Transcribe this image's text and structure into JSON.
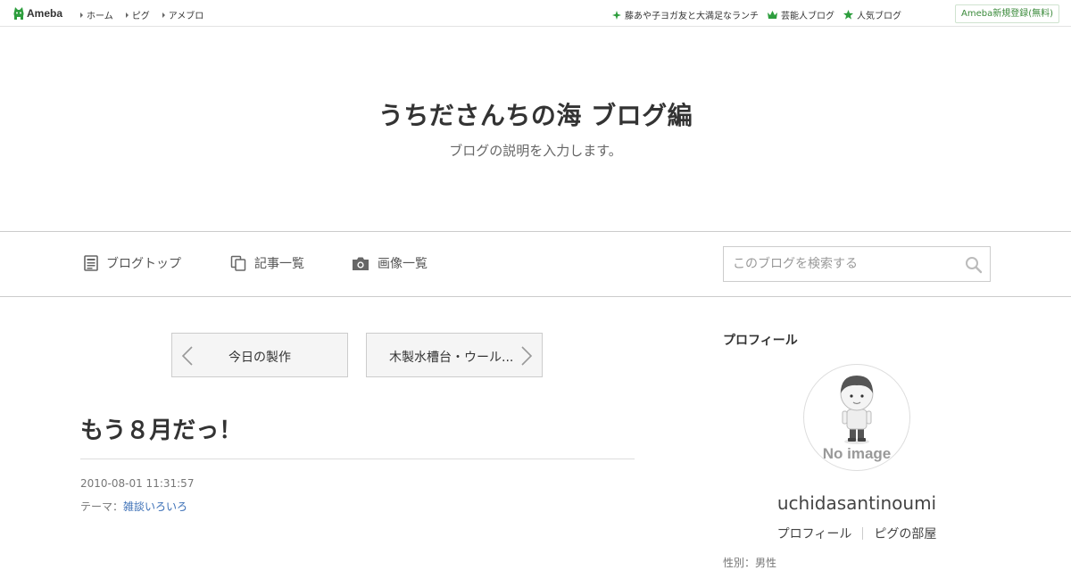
{
  "topbar": {
    "logo_text": "Ameba",
    "nav": [
      "ホーム",
      "ピグ",
      "アメブロ"
    ],
    "right_links": [
      {
        "icon": "sparkle-icon",
        "label": "藤あや子ヨガ友と大満足なランチ"
      },
      {
        "icon": "crown-icon",
        "label": "芸能人ブログ"
      },
      {
        "icon": "star-icon",
        "label": "人気ブログ"
      }
    ],
    "register_label": "Ameba新規登録(無料)"
  },
  "header": {
    "title": "うちださんちの海 ブログ編",
    "description": "ブログの説明を入力します。"
  },
  "nav": {
    "blog_top": "ブログトップ",
    "entry_list": "記事一覧",
    "image_list": "画像一覧",
    "search_placeholder": "このブログを検索する"
  },
  "pager": {
    "prev": "今日の製作",
    "next": "木製水槽台・ウール..."
  },
  "entry": {
    "title": "もう８月だっ！",
    "date": "2010-08-01 11:31:57",
    "theme_label": "テーマ：",
    "theme": "雑談いろいろ"
  },
  "sidebar": {
    "heading": "プロフィール",
    "avatar_text": "No image",
    "username": "uchidasantinoumi",
    "links": [
      "プロフィール",
      "ピグの部屋"
    ],
    "cut_text": "性別：男性"
  },
  "colors": {
    "accent_green": "#2e9e3e",
    "link_blue": "#3b6fb6"
  }
}
